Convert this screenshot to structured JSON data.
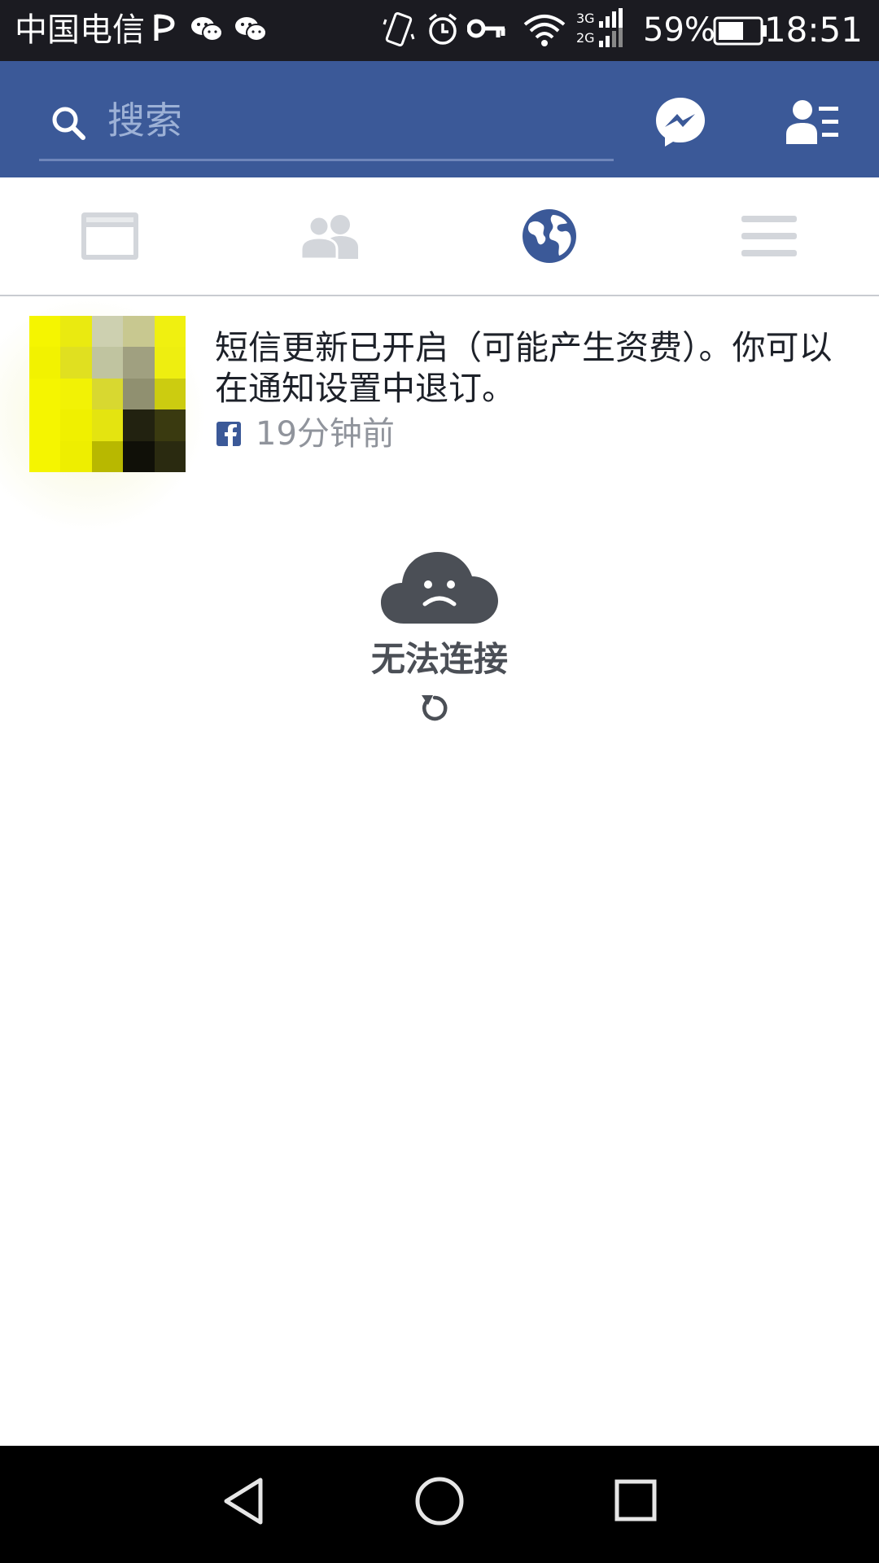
{
  "status_bar": {
    "carrier": "中国电信",
    "network": "3G 2G",
    "battery_percent": "59%",
    "time": "18:51",
    "icons": [
      "p-notification-icon",
      "wechat-icon",
      "wechat-icon",
      "vibrate-icon",
      "alarm-icon",
      "vpn-key-icon",
      "wifi-icon",
      "signal-icon",
      "battery-icon"
    ]
  },
  "header": {
    "search_placeholder": "搜索",
    "messenger_icon": "messenger-icon",
    "friend_requests_icon": "friend-requests-icon"
  },
  "tabs": [
    {
      "name": "news-feed",
      "icon": "news-feed-icon",
      "active": false
    },
    {
      "name": "friends",
      "icon": "friends-icon",
      "active": false
    },
    {
      "name": "notifications",
      "icon": "globe-icon",
      "active": true
    },
    {
      "name": "menu",
      "icon": "menu-icon",
      "active": false
    }
  ],
  "notification": {
    "text": "短信更新已开启（可能产生资费）。你可以在通知设置中退订。",
    "time": "19分钟前",
    "source_icon": "facebook-icon"
  },
  "error": {
    "message": "无法连接",
    "icon": "sad-cloud-icon",
    "retry_icon": "refresh-icon"
  },
  "colors": {
    "brand_blue": "#3b5998",
    "status_bar": "#1b1b21",
    "text_dark": "#1d2129",
    "text_muted": "#90949c",
    "tab_inactive": "#d3d6db",
    "error_grey": "#4b4f56"
  },
  "nav_bar": {
    "icons": [
      "back-icon",
      "home-icon",
      "recents-icon"
    ]
  }
}
